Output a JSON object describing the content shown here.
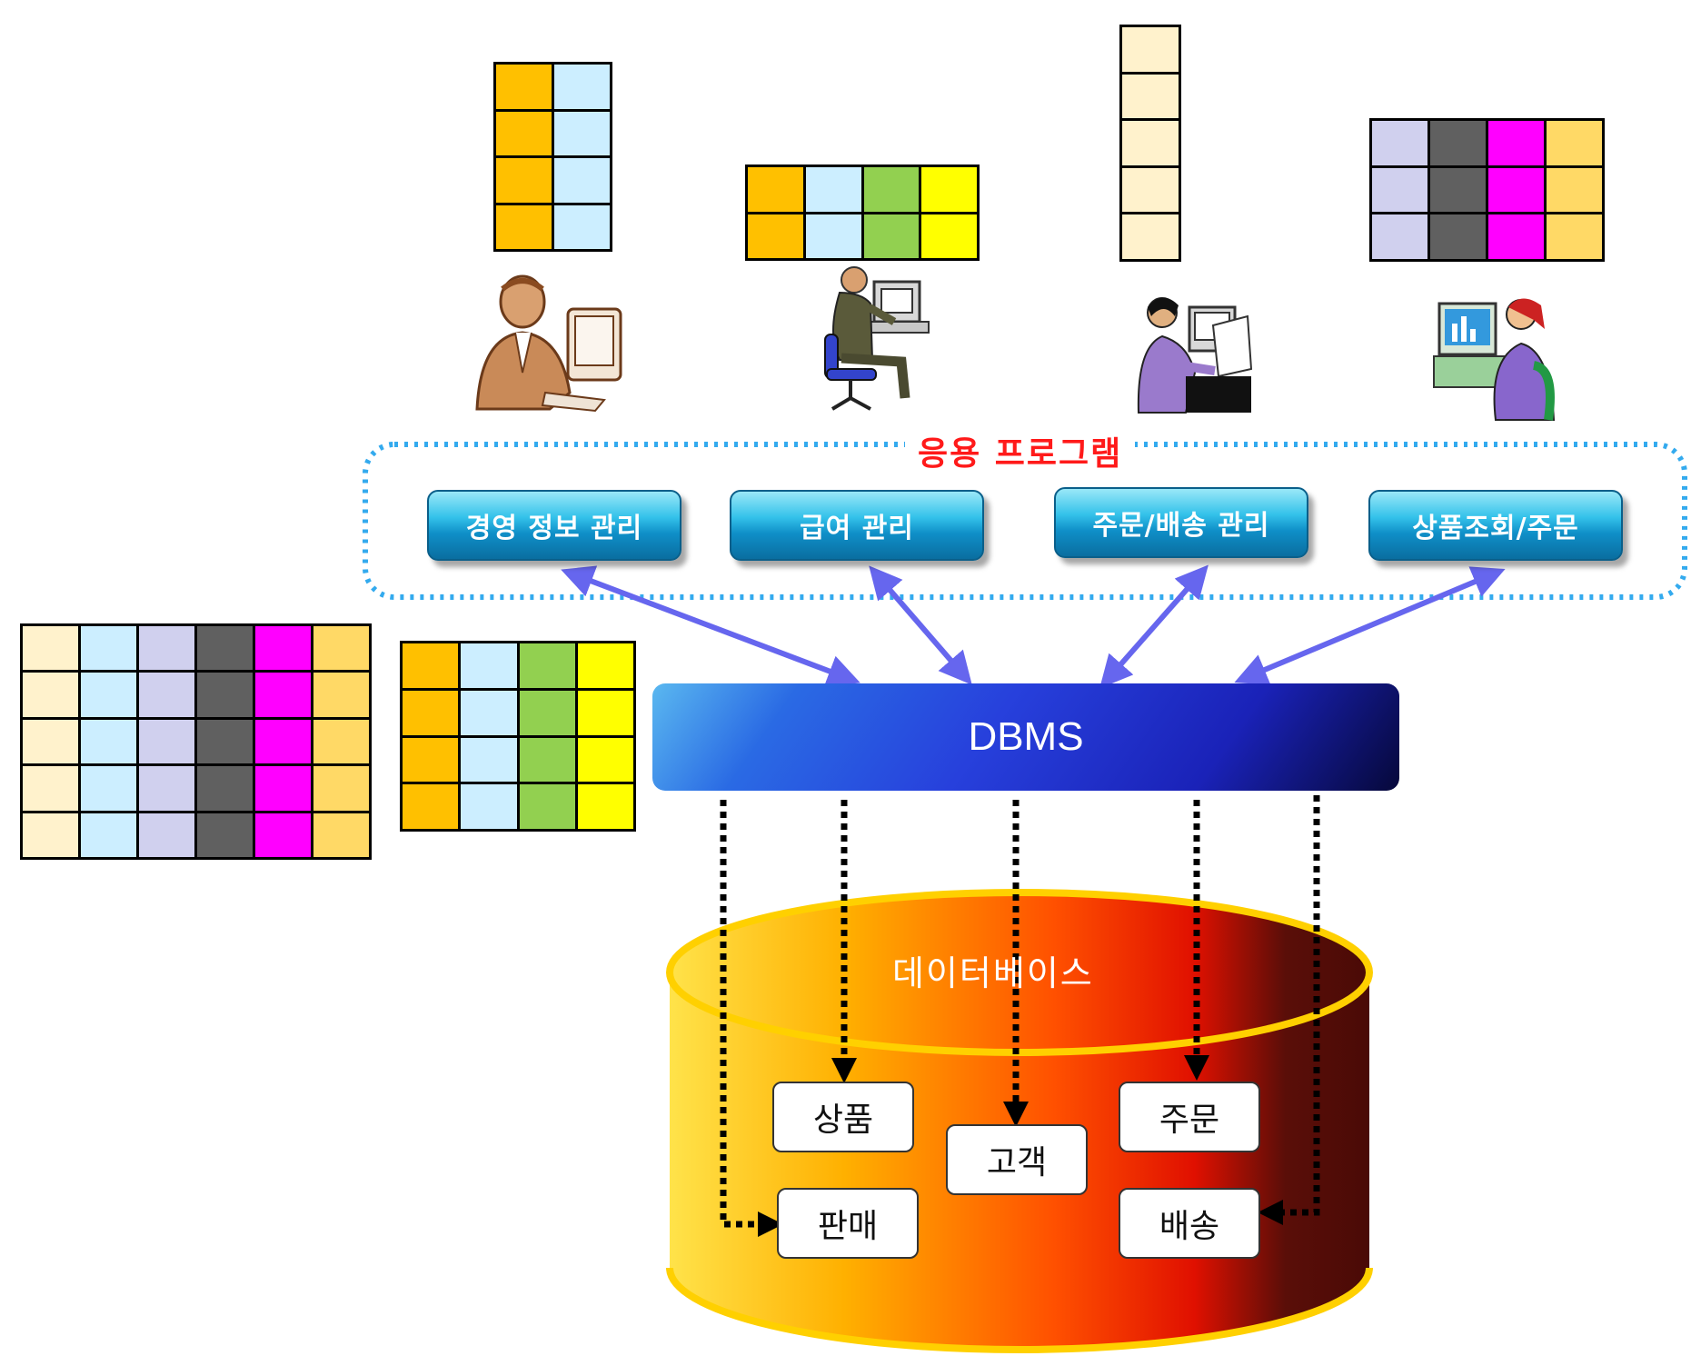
{
  "app_group": {
    "label": "응용 프로그램",
    "programs": [
      {
        "label": "경영 정보 관리"
      },
      {
        "label": "급여 관리"
      },
      {
        "label": "주문/배송 관리"
      },
      {
        "label": "상품조회/주문"
      }
    ]
  },
  "dbms": {
    "label": "DBMS"
  },
  "database": {
    "label": "데이터베이스",
    "entities": [
      {
        "label": "상품"
      },
      {
        "label": "고객"
      },
      {
        "label": "주문"
      },
      {
        "label": "판매"
      },
      {
        "label": "배송"
      }
    ]
  },
  "users": [
    {
      "icon": "businessman-computer-icon"
    },
    {
      "icon": "man-chair-terminal-icon"
    },
    {
      "icon": "woman-typing-icon"
    },
    {
      "icon": "woman-monitor-icon"
    }
  ],
  "colors": {
    "orange": "#ffc000",
    "light_blue": "#cceeff",
    "green": "#92d050",
    "yellow": "#ffff00",
    "cream": "#fff2cc",
    "lavender": "#d0d0ee",
    "dark_gray": "#606060",
    "magenta": "#ff00ff",
    "gold": "#ffd966",
    "arrow": "#6666ee",
    "dotted_border": "#33aaee",
    "label_red": "#ff1a1a"
  }
}
